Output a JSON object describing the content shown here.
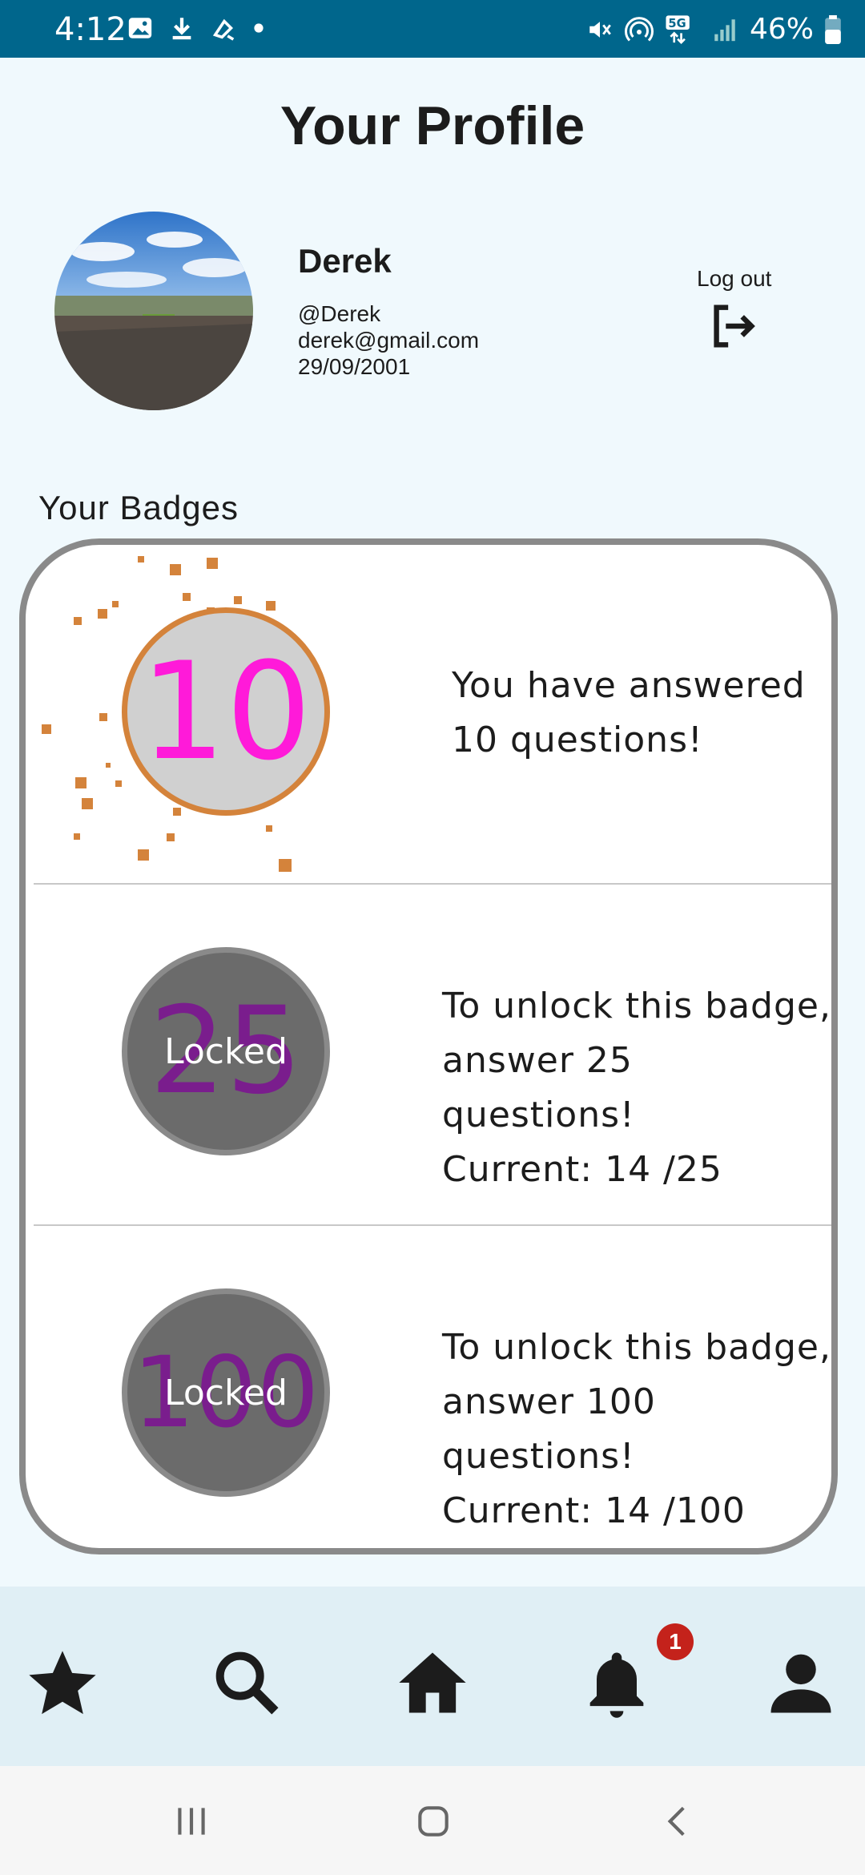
{
  "status_bar": {
    "time": "4:12",
    "battery": "46%",
    "icons": [
      "gallery-icon",
      "download-icon",
      "sync-icon",
      "dot-icon",
      "mute-icon",
      "hotspot-icon",
      "5g-icon",
      "signal-icon",
      "battery-icon"
    ]
  },
  "header": {
    "title": "Your Profile"
  },
  "profile": {
    "name": "Derek",
    "username": "@Derek",
    "email": "derek@gmail.com",
    "birthdate": "29/09/2001",
    "logout_label": "Log out"
  },
  "badges": {
    "section_title": "Your Badges",
    "items": [
      {
        "number": "10",
        "locked": false,
        "text_line1": "You have answered",
        "text_line2": "10 questions!",
        "text_line3": ""
      },
      {
        "number": "25",
        "locked": true,
        "locked_label": "Locked",
        "text_line1": "To unlock this badge,",
        "text_line2": "answer 25 questions!",
        "text_line3": "Current: 14 /25"
      },
      {
        "number": "100",
        "locked": true,
        "locked_label": "Locked",
        "text_line1": "To unlock this badge,",
        "text_line2": "answer 100 questions!",
        "text_line3": "Current: 14 /100"
      }
    ]
  },
  "bottom_nav": {
    "items": [
      "star-icon",
      "search-icon",
      "home-icon",
      "bell-icon",
      "person-icon"
    ],
    "notification_count": "1"
  },
  "colors": {
    "status_bar": "#00668c",
    "background": "#f0f9fd",
    "badge_unlocked_ring": "#d4833b",
    "badge_number": "#ff1ad9",
    "badge_locked_fill": "#6b6b6b",
    "notification": "#c4221b"
  }
}
